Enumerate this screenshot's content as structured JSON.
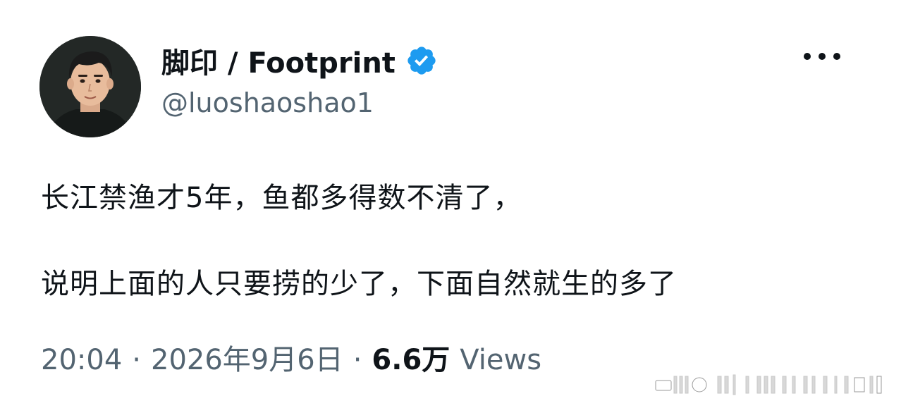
{
  "author": {
    "display_name": "脚印 / Footprint",
    "handle": "@luoshaoshao1",
    "verified_icon": "verified-badge-icon",
    "verified_color": "#1d9bf0"
  },
  "tweet": {
    "lines": [
      "长江禁渔才5年，鱼都多得数不清了，",
      "说明上面的人只要捞的少了，下面自然就生的多了"
    ]
  },
  "meta": {
    "time": "20:04",
    "separator": "·",
    "date": "2026年9月6日",
    "views_count": "6.6万",
    "views_label": "Views"
  },
  "actions": {
    "more_icon": "more-options-icon"
  },
  "colors": {
    "text_primary": "#0f1419",
    "text_secondary": "#536471",
    "background": "#ffffff"
  }
}
